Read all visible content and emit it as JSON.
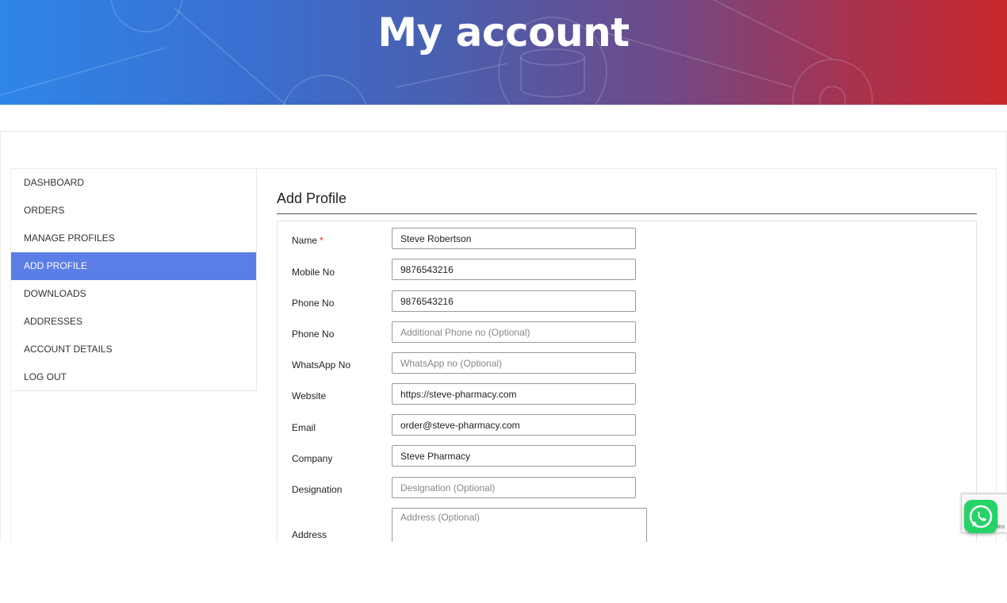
{
  "hero": {
    "title": "My account"
  },
  "sidebar": {
    "active": "ADD PROFILE",
    "items": [
      {
        "label": "DASHBOARD"
      },
      {
        "label": "ORDERS"
      },
      {
        "label": "MANAGE PROFILES"
      },
      {
        "label": "ADD PROFILE"
      },
      {
        "label": "DOWNLOADS"
      },
      {
        "label": "ADDRESSES"
      },
      {
        "label": "ACCOUNT DETAILS"
      },
      {
        "label": "LOG OUT"
      }
    ]
  },
  "form": {
    "title": "Add Profile",
    "required_mark": "*",
    "fields": {
      "name": {
        "label": "Name",
        "value": "Steve Robertson"
      },
      "mobile": {
        "label": "Mobile No",
        "value": "9876543216"
      },
      "phone": {
        "label": "Phone No",
        "value": "9876543216"
      },
      "phone2": {
        "label": "Phone No",
        "placeholder": "Additional Phone no (Optional)"
      },
      "whatsapp": {
        "label": "WhatsApp No",
        "placeholder": "WhatsApp no (Optional)"
      },
      "website": {
        "label": "Website",
        "value": "https://steve-pharmacy.com"
      },
      "email": {
        "label": "Email",
        "value": "order@steve-pharmacy.com"
      },
      "company": {
        "label": "Company",
        "value": "Steve Pharmacy"
      },
      "designation": {
        "label": "Designation",
        "placeholder": "Designation (Optional)"
      },
      "address": {
        "label": "Address",
        "placeholder": "Address (Optional)"
      }
    }
  },
  "recaptcha": {
    "text": "rms"
  },
  "colors": {
    "accent": "#5b7de6",
    "whatsapp": "#25d366",
    "hero_left": "#2e86e8",
    "hero_right": "#c8282a"
  }
}
